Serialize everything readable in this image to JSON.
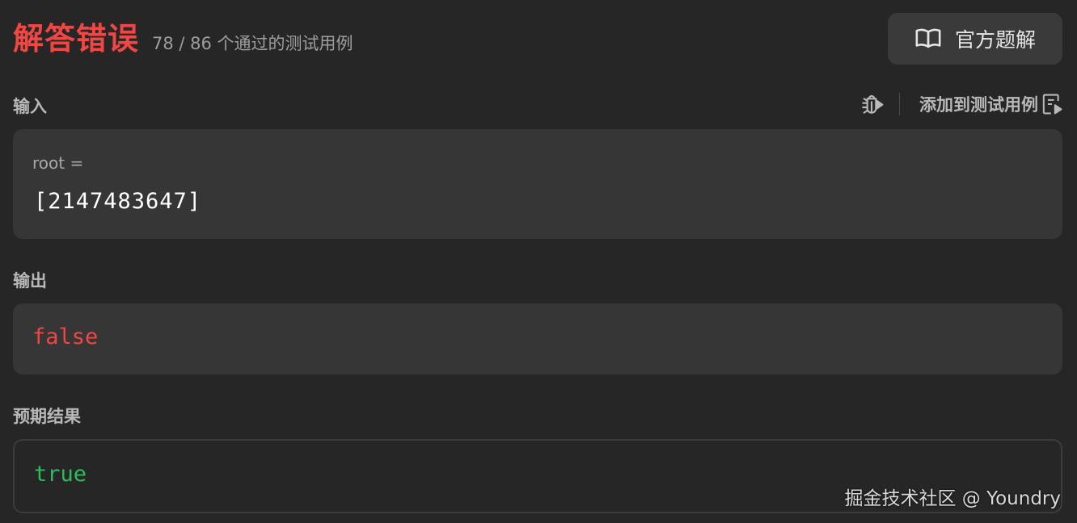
{
  "header": {
    "status": "解答错误",
    "pass_info": "78 / 86 个通过的测试用例",
    "solution_button": "官方题解",
    "status_color": "#ef4743"
  },
  "input": {
    "label": "输入",
    "param_name": "root =",
    "param_value": "[2147483647]",
    "add_test_label": "添加到测试用例",
    "icons": [
      "debug-icon",
      "add-testcase-icon"
    ]
  },
  "output": {
    "label": "输出",
    "value": "false",
    "color": "#ef4743"
  },
  "expected": {
    "label": "预期结果",
    "value": "true",
    "color": "#2cbb5d"
  },
  "watermark": "掘金技术社区 @ Youndry"
}
